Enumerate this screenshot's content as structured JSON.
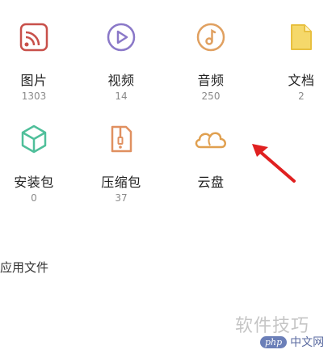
{
  "categories": [
    {
      "id": "photos",
      "label": "图片",
      "count": "1303",
      "icon": "image-icon",
      "color": "#c8504a"
    },
    {
      "id": "video",
      "label": "视频",
      "count": "14",
      "icon": "video-play-icon",
      "color": "#8a78c8"
    },
    {
      "id": "audio",
      "label": "音频",
      "count": "250",
      "icon": "music-note-icon",
      "color": "#e0a060"
    },
    {
      "id": "docs",
      "label": "文档",
      "count": "2",
      "icon": "document-icon",
      "color": "#e8c040"
    },
    {
      "id": "apk",
      "label": "安装包",
      "count": "0",
      "icon": "package-cube-icon",
      "color": "#4fbf9a"
    },
    {
      "id": "zip",
      "label": "压缩包",
      "count": "37",
      "icon": "zip-archive-icon",
      "color": "#e09060"
    },
    {
      "id": "cloud",
      "label": "云盘",
      "count": "",
      "icon": "cloud-icon",
      "color": "#e0a050"
    }
  ],
  "section": {
    "apps_label": "应用文件"
  },
  "watermark": {
    "line1": "软件技巧",
    "badge": "php",
    "badge_text": "中文网"
  },
  "annotation": {
    "arrow_color": "#e02020"
  }
}
